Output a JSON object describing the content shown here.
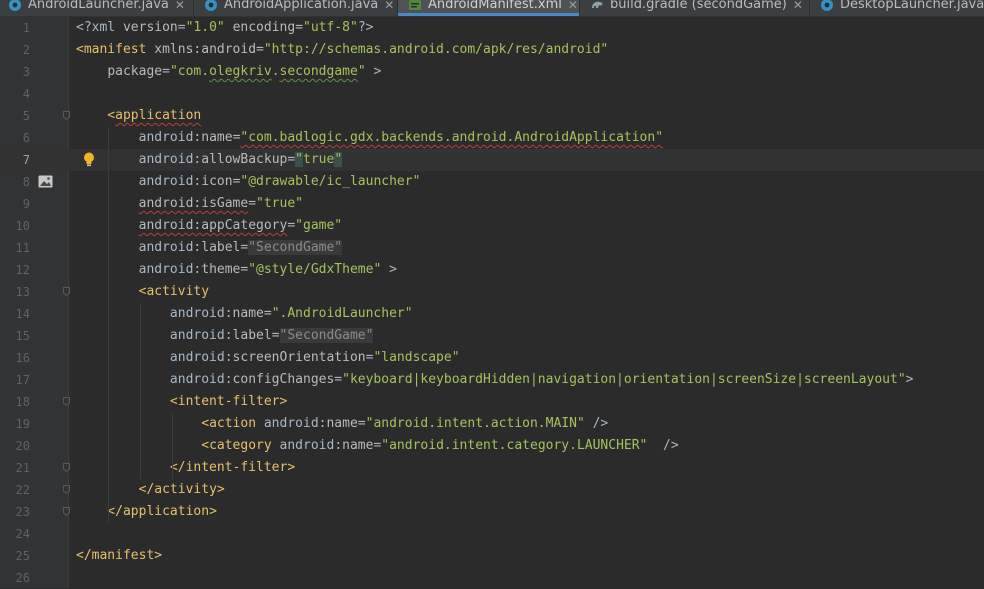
{
  "tabs": [
    {
      "label": "AndroidLauncher.java",
      "icon": "java-class-icon",
      "active": false
    },
    {
      "label": "AndroidApplication.java",
      "icon": "java-class-icon",
      "active": false
    },
    {
      "label": "AndroidManifest.xml",
      "icon": "xml-manifest-icon",
      "active": true
    },
    {
      "label": "build.gradle (secondGame)",
      "icon": "gradle-icon",
      "active": false
    },
    {
      "label": "DesktopLauncher.java",
      "icon": "java-class-icon",
      "active": false
    }
  ],
  "colors": {
    "background": "#2b2b2b",
    "gutter": "#313335",
    "tag": "#e8bf6a",
    "attribute": "#bababa",
    "value": "#6a8759",
    "active_tab_indicator": "#4a88c7",
    "error_underline": "#bc3f3c"
  },
  "editor": {
    "current_line": 7,
    "lines": [
      {
        "n": "1",
        "segs": [
          {
            "t": "<?",
            "c": "t-plain"
          },
          {
            "t": "xml ",
            "c": "t-plain"
          },
          {
            "t": "version",
            "c": "t-attr"
          },
          {
            "t": "=",
            "c": "t-plain"
          },
          {
            "t": "\"1.0\"",
            "c": "t-val2"
          },
          {
            "t": " ",
            "c": "t-plain"
          },
          {
            "t": "encoding",
            "c": "t-attr"
          },
          {
            "t": "=",
            "c": "t-plain"
          },
          {
            "t": "\"utf-8\"",
            "c": "t-val2"
          },
          {
            "t": "?>",
            "c": "t-plain"
          }
        ]
      },
      {
        "n": "2",
        "segs": [
          {
            "t": "<",
            "c": "t-tag"
          },
          {
            "t": "manifest",
            "c": "t-tag"
          },
          {
            "t": " ",
            "c": "t-plain"
          },
          {
            "t": "xmlns:android",
            "c": "t-attr"
          },
          {
            "t": "=",
            "c": "t-plain"
          },
          {
            "t": "\"http://schemas.android.com/apk/res/android\"",
            "c": "t-val2"
          }
        ]
      },
      {
        "n": "3",
        "segs": [
          {
            "t": "    ",
            "c": "t-plain"
          },
          {
            "t": "package",
            "c": "t-attr"
          },
          {
            "t": "=",
            "c": "t-plain"
          },
          {
            "t": "\"com.",
            "c": "t-val2"
          },
          {
            "t": "olegkriv",
            "c": "t-val2 gdx-ul"
          },
          {
            "t": ".",
            "c": "t-val2"
          },
          {
            "t": "secondgame",
            "c": "t-val2 gdx-ul"
          },
          {
            "t": "\"",
            "c": "t-val2"
          },
          {
            "t": " >",
            "c": "t-plain"
          }
        ]
      },
      {
        "n": "4",
        "segs": []
      },
      {
        "n": "5",
        "segs": [
          {
            "t": "    <",
            "c": "t-tag"
          },
          {
            "t": "application",
            "c": "t-tag squiggle"
          }
        ]
      },
      {
        "n": "6",
        "segs": [
          {
            "t": "        ",
            "c": "t-plain"
          },
          {
            "t": "android",
            "c": "t-plain"
          },
          {
            "t": ":",
            "c": "t-plain"
          },
          {
            "t": "name",
            "c": "t-attr"
          },
          {
            "t": "=",
            "c": "t-plain"
          },
          {
            "t": "\"com.badlogic.gdx.backends.android.AndroidApplication\"",
            "c": "t-val2 squiggle"
          }
        ]
      },
      {
        "n": "7",
        "segs": [
          {
            "t": "        ",
            "c": "t-plain"
          },
          {
            "t": "android",
            "c": "t-plain"
          },
          {
            "t": ":",
            "c": "t-plain"
          },
          {
            "t": "allowBackup",
            "c": "t-attr"
          },
          {
            "t": "=",
            "c": "t-plain"
          },
          {
            "t": "\"",
            "c": "t-val2 hl"
          },
          {
            "t": "true",
            "c": "t-val2"
          },
          {
            "t": "\"",
            "c": "t-val2 hl"
          }
        ]
      },
      {
        "n": "8",
        "segs": [
          {
            "t": "        ",
            "c": "t-plain"
          },
          {
            "t": "android",
            "c": "t-plain"
          },
          {
            "t": ":",
            "c": "t-plain"
          },
          {
            "t": "icon",
            "c": "t-attr"
          },
          {
            "t": "=",
            "c": "t-plain"
          },
          {
            "t": "\"@drawable/ic_launcher\"",
            "c": "t-val2"
          }
        ]
      },
      {
        "n": "9",
        "segs": [
          {
            "t": "        ",
            "c": "t-plain"
          },
          {
            "t": "android:isGame",
            "c": "t-attr squiggle"
          },
          {
            "t": "=",
            "c": "t-plain"
          },
          {
            "t": "\"true\"",
            "c": "t-val2"
          }
        ]
      },
      {
        "n": "10",
        "segs": [
          {
            "t": "        ",
            "c": "t-plain"
          },
          {
            "t": "android:appCategory",
            "c": "t-attr squiggle"
          },
          {
            "t": "=",
            "c": "t-plain"
          },
          {
            "t": "\"game\"",
            "c": "t-val2"
          }
        ]
      },
      {
        "n": "11",
        "segs": [
          {
            "t": "        ",
            "c": "t-plain"
          },
          {
            "t": "android",
            "c": "t-plain"
          },
          {
            "t": ":",
            "c": "t-plain"
          },
          {
            "t": "label",
            "c": "t-attr"
          },
          {
            "t": "=",
            "c": "t-plain"
          },
          {
            "t": "\"SecondGame\"",
            "c": "folded"
          }
        ]
      },
      {
        "n": "12",
        "segs": [
          {
            "t": "        ",
            "c": "t-plain"
          },
          {
            "t": "android",
            "c": "t-plain"
          },
          {
            "t": ":",
            "c": "t-plain"
          },
          {
            "t": "theme",
            "c": "t-attr"
          },
          {
            "t": "=",
            "c": "t-plain"
          },
          {
            "t": "\"@style/GdxTheme\"",
            "c": "t-val2"
          },
          {
            "t": " >",
            "c": "t-plain"
          }
        ]
      },
      {
        "n": "13",
        "segs": [
          {
            "t": "        <",
            "c": "t-tag"
          },
          {
            "t": "activity",
            "c": "t-tag"
          }
        ]
      },
      {
        "n": "14",
        "segs": [
          {
            "t": "            ",
            "c": "t-plain"
          },
          {
            "t": "android",
            "c": "t-plain"
          },
          {
            "t": ":",
            "c": "t-plain"
          },
          {
            "t": "name",
            "c": "t-attr"
          },
          {
            "t": "=",
            "c": "t-plain"
          },
          {
            "t": "\".AndroidLauncher\"",
            "c": "t-val2"
          }
        ]
      },
      {
        "n": "15",
        "segs": [
          {
            "t": "            ",
            "c": "t-plain"
          },
          {
            "t": "android",
            "c": "t-plain"
          },
          {
            "t": ":",
            "c": "t-plain"
          },
          {
            "t": "label",
            "c": "t-attr"
          },
          {
            "t": "=",
            "c": "t-plain"
          },
          {
            "t": "\"SecondGame\"",
            "c": "folded"
          }
        ]
      },
      {
        "n": "16",
        "segs": [
          {
            "t": "            ",
            "c": "t-plain"
          },
          {
            "t": "android",
            "c": "t-plain"
          },
          {
            "t": ":",
            "c": "t-plain"
          },
          {
            "t": "screenOrientation",
            "c": "t-attr"
          },
          {
            "t": "=",
            "c": "t-plain"
          },
          {
            "t": "\"landscape\"",
            "c": "t-val2"
          }
        ]
      },
      {
        "n": "17",
        "segs": [
          {
            "t": "            ",
            "c": "t-plain"
          },
          {
            "t": "android",
            "c": "t-plain"
          },
          {
            "t": ":",
            "c": "t-plain"
          },
          {
            "t": "configChanges",
            "c": "t-attr"
          },
          {
            "t": "=",
            "c": "t-plain"
          },
          {
            "t": "\"keyboard|keyboardHidden|navigation|orientation|screenSize|screenLayout\"",
            "c": "t-val2"
          },
          {
            "t": ">",
            "c": "t-plain"
          }
        ]
      },
      {
        "n": "18",
        "segs": [
          {
            "t": "            <",
            "c": "t-tag"
          },
          {
            "t": "intent-filter",
            "c": "t-tag"
          },
          {
            "t": ">",
            "c": "t-tag"
          }
        ]
      },
      {
        "n": "19",
        "segs": [
          {
            "t": "                <",
            "c": "t-tag"
          },
          {
            "t": "action",
            "c": "t-tag"
          },
          {
            "t": " ",
            "c": "t-plain"
          },
          {
            "t": "android",
            "c": "t-plain"
          },
          {
            "t": ":",
            "c": "t-plain"
          },
          {
            "t": "name",
            "c": "t-attr"
          },
          {
            "t": "=",
            "c": "t-plain"
          },
          {
            "t": "\"android.intent.action.MAIN\"",
            "c": "t-val2"
          },
          {
            "t": " />",
            "c": "t-plain"
          }
        ]
      },
      {
        "n": "20",
        "segs": [
          {
            "t": "                <",
            "c": "t-tag"
          },
          {
            "t": "category",
            "c": "t-tag"
          },
          {
            "t": " ",
            "c": "t-plain"
          },
          {
            "t": "android",
            "c": "t-plain"
          },
          {
            "t": ":",
            "c": "t-plain"
          },
          {
            "t": "name",
            "c": "t-attr"
          },
          {
            "t": "=",
            "c": "t-plain"
          },
          {
            "t": "\"android.intent.category.LAUNCHER\"",
            "c": "t-val2"
          },
          {
            "t": "  />",
            "c": "t-plain"
          }
        ]
      },
      {
        "n": "21",
        "segs": [
          {
            "t": "            </",
            "c": "t-tag"
          },
          {
            "t": "intent-filter",
            "c": "t-tag"
          },
          {
            "t": ">",
            "c": "t-tag"
          }
        ]
      },
      {
        "n": "22",
        "segs": [
          {
            "t": "        </",
            "c": "t-tag"
          },
          {
            "t": "activity",
            "c": "t-tag"
          },
          {
            "t": ">",
            "c": "t-tag"
          }
        ]
      },
      {
        "n": "23",
        "segs": [
          {
            "t": "    </",
            "c": "t-tag"
          },
          {
            "t": "application",
            "c": "t-tag"
          },
          {
            "t": ">",
            "c": "t-tag"
          }
        ]
      },
      {
        "n": "24",
        "segs": []
      },
      {
        "n": "25",
        "segs": [
          {
            "t": "</",
            "c": "t-tag"
          },
          {
            "t": "manifest",
            "c": "t-tag"
          },
          {
            "t": ">",
            "c": "t-tag"
          }
        ]
      },
      {
        "n": "26",
        "segs": []
      }
    ]
  }
}
